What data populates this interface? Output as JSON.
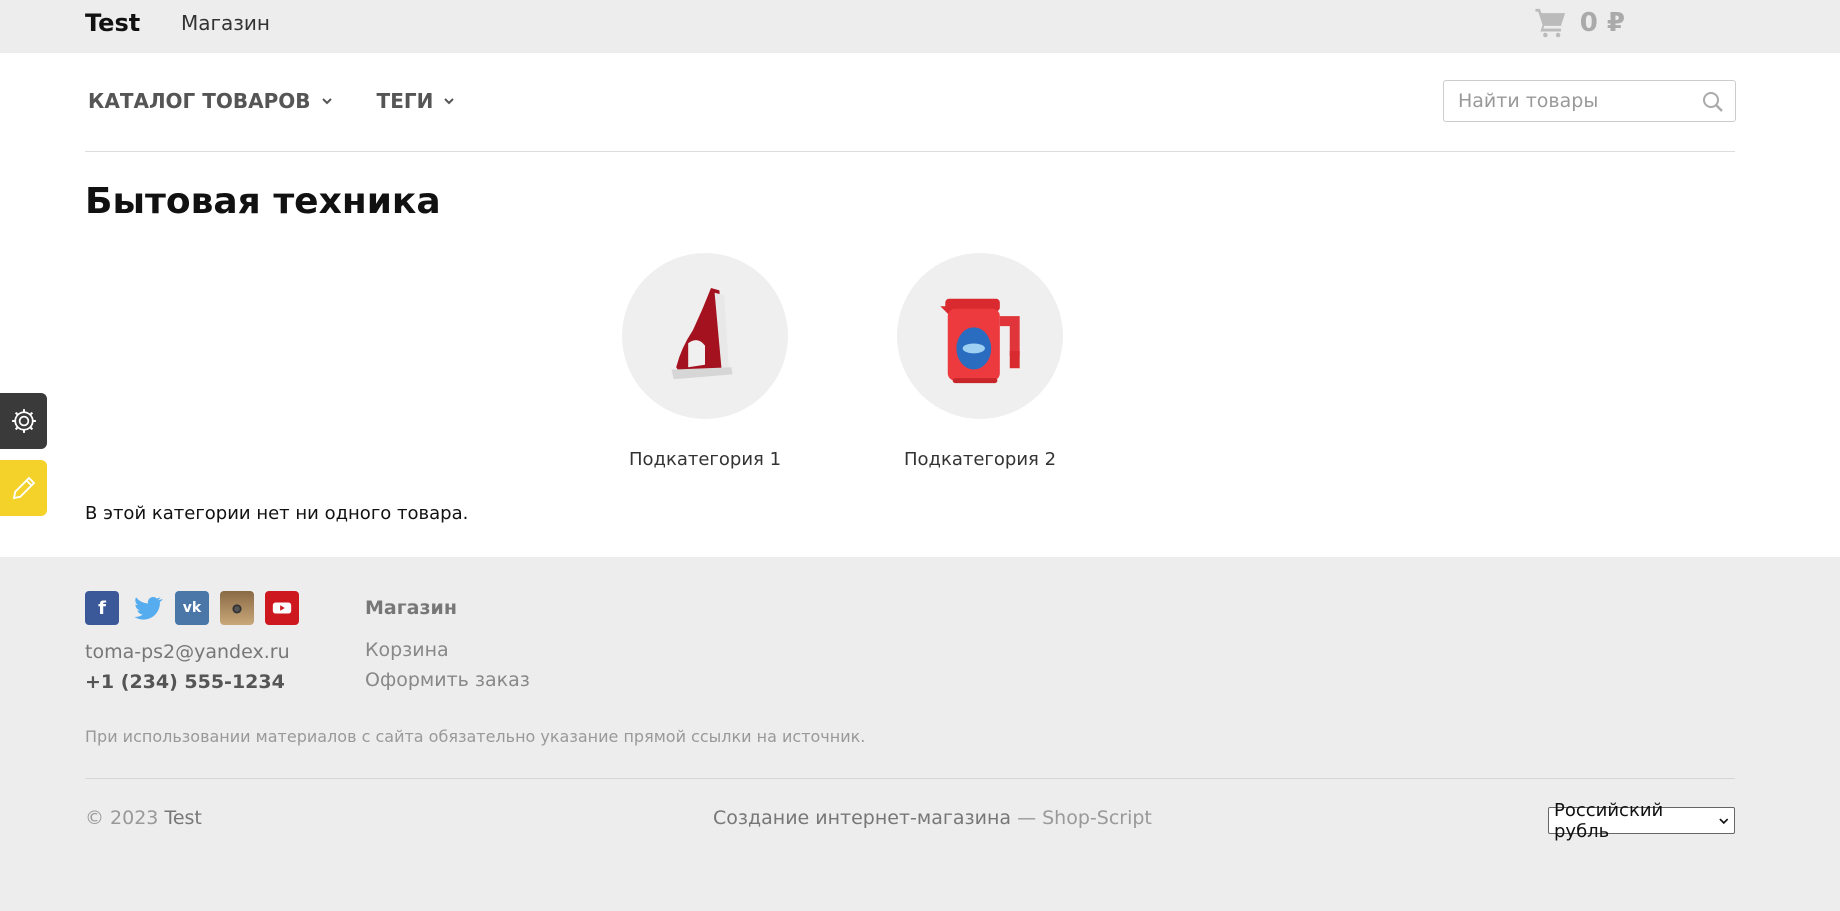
{
  "topbar": {
    "brand": "Test",
    "shop_link": "Магазин",
    "cart_total": "0 ₽"
  },
  "nav": {
    "catalog": "Каталог товаров",
    "tags": "Теги"
  },
  "search": {
    "placeholder": "Найти товары",
    "value": ""
  },
  "page": {
    "title": "Бытовая техника",
    "subcategories": [
      {
        "label": "Подкатегория 1",
        "icon": "iron-image"
      },
      {
        "label": "Подкатегория 2",
        "icon": "kettle-image"
      }
    ],
    "empty_message": "В этой категории нет ни одного товара."
  },
  "footer": {
    "socials": [
      "facebook-icon",
      "twitter-icon",
      "vk-icon",
      "instagram-icon",
      "youtube-icon"
    ],
    "email": "toma-ps2@yandex.ru",
    "phone": "+1 (234) 555-1234",
    "column_title": "Магазин",
    "links": [
      "Корзина",
      "Оформить заказ"
    ],
    "disclaimer": "При использовании материалов с сайта обязательно указание прямой ссылки на источник.",
    "copyright_prefix": "© 2023",
    "copyright_site": "Test",
    "credits_text": "Создание интернет-магазина",
    "credits_dash": "—",
    "credits_link": "Shop-Script",
    "currency": "Российский рубль"
  },
  "colors": {
    "accent_yellow": "#f4d22a",
    "dark_panel": "#3a3a3a",
    "background": "#ededed"
  }
}
